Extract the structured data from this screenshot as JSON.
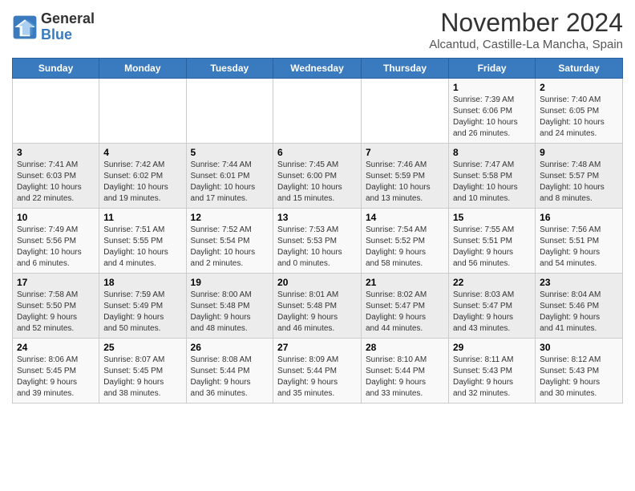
{
  "header": {
    "logo_line1": "General",
    "logo_line2": "Blue",
    "title": "November 2024",
    "subtitle": "Alcantud, Castille-La Mancha, Spain"
  },
  "weekdays": [
    "Sunday",
    "Monday",
    "Tuesday",
    "Wednesday",
    "Thursday",
    "Friday",
    "Saturday"
  ],
  "weeks": [
    [
      {
        "day": "",
        "info": ""
      },
      {
        "day": "",
        "info": ""
      },
      {
        "day": "",
        "info": ""
      },
      {
        "day": "",
        "info": ""
      },
      {
        "day": "",
        "info": ""
      },
      {
        "day": "1",
        "info": "Sunrise: 7:39 AM\nSunset: 6:06 PM\nDaylight: 10 hours\nand 26 minutes."
      },
      {
        "day": "2",
        "info": "Sunrise: 7:40 AM\nSunset: 6:05 PM\nDaylight: 10 hours\nand 24 minutes."
      }
    ],
    [
      {
        "day": "3",
        "info": "Sunrise: 7:41 AM\nSunset: 6:03 PM\nDaylight: 10 hours\nand 22 minutes."
      },
      {
        "day": "4",
        "info": "Sunrise: 7:42 AM\nSunset: 6:02 PM\nDaylight: 10 hours\nand 19 minutes."
      },
      {
        "day": "5",
        "info": "Sunrise: 7:44 AM\nSunset: 6:01 PM\nDaylight: 10 hours\nand 17 minutes."
      },
      {
        "day": "6",
        "info": "Sunrise: 7:45 AM\nSunset: 6:00 PM\nDaylight: 10 hours\nand 15 minutes."
      },
      {
        "day": "7",
        "info": "Sunrise: 7:46 AM\nSunset: 5:59 PM\nDaylight: 10 hours\nand 13 minutes."
      },
      {
        "day": "8",
        "info": "Sunrise: 7:47 AM\nSunset: 5:58 PM\nDaylight: 10 hours\nand 10 minutes."
      },
      {
        "day": "9",
        "info": "Sunrise: 7:48 AM\nSunset: 5:57 PM\nDaylight: 10 hours\nand 8 minutes."
      }
    ],
    [
      {
        "day": "10",
        "info": "Sunrise: 7:49 AM\nSunset: 5:56 PM\nDaylight: 10 hours\nand 6 minutes."
      },
      {
        "day": "11",
        "info": "Sunrise: 7:51 AM\nSunset: 5:55 PM\nDaylight: 10 hours\nand 4 minutes."
      },
      {
        "day": "12",
        "info": "Sunrise: 7:52 AM\nSunset: 5:54 PM\nDaylight: 10 hours\nand 2 minutes."
      },
      {
        "day": "13",
        "info": "Sunrise: 7:53 AM\nSunset: 5:53 PM\nDaylight: 10 hours\nand 0 minutes."
      },
      {
        "day": "14",
        "info": "Sunrise: 7:54 AM\nSunset: 5:52 PM\nDaylight: 9 hours\nand 58 minutes."
      },
      {
        "day": "15",
        "info": "Sunrise: 7:55 AM\nSunset: 5:51 PM\nDaylight: 9 hours\nand 56 minutes."
      },
      {
        "day": "16",
        "info": "Sunrise: 7:56 AM\nSunset: 5:51 PM\nDaylight: 9 hours\nand 54 minutes."
      }
    ],
    [
      {
        "day": "17",
        "info": "Sunrise: 7:58 AM\nSunset: 5:50 PM\nDaylight: 9 hours\nand 52 minutes."
      },
      {
        "day": "18",
        "info": "Sunrise: 7:59 AM\nSunset: 5:49 PM\nDaylight: 9 hours\nand 50 minutes."
      },
      {
        "day": "19",
        "info": "Sunrise: 8:00 AM\nSunset: 5:48 PM\nDaylight: 9 hours\nand 48 minutes."
      },
      {
        "day": "20",
        "info": "Sunrise: 8:01 AM\nSunset: 5:48 PM\nDaylight: 9 hours\nand 46 minutes."
      },
      {
        "day": "21",
        "info": "Sunrise: 8:02 AM\nSunset: 5:47 PM\nDaylight: 9 hours\nand 44 minutes."
      },
      {
        "day": "22",
        "info": "Sunrise: 8:03 AM\nSunset: 5:47 PM\nDaylight: 9 hours\nand 43 minutes."
      },
      {
        "day": "23",
        "info": "Sunrise: 8:04 AM\nSunset: 5:46 PM\nDaylight: 9 hours\nand 41 minutes."
      }
    ],
    [
      {
        "day": "24",
        "info": "Sunrise: 8:06 AM\nSunset: 5:45 PM\nDaylight: 9 hours\nand 39 minutes."
      },
      {
        "day": "25",
        "info": "Sunrise: 8:07 AM\nSunset: 5:45 PM\nDaylight: 9 hours\nand 38 minutes."
      },
      {
        "day": "26",
        "info": "Sunrise: 8:08 AM\nSunset: 5:44 PM\nDaylight: 9 hours\nand 36 minutes."
      },
      {
        "day": "27",
        "info": "Sunrise: 8:09 AM\nSunset: 5:44 PM\nDaylight: 9 hours\nand 35 minutes."
      },
      {
        "day": "28",
        "info": "Sunrise: 8:10 AM\nSunset: 5:44 PM\nDaylight: 9 hours\nand 33 minutes."
      },
      {
        "day": "29",
        "info": "Sunrise: 8:11 AM\nSunset: 5:43 PM\nDaylight: 9 hours\nand 32 minutes."
      },
      {
        "day": "30",
        "info": "Sunrise: 8:12 AM\nSunset: 5:43 PM\nDaylight: 9 hours\nand 30 minutes."
      }
    ]
  ]
}
